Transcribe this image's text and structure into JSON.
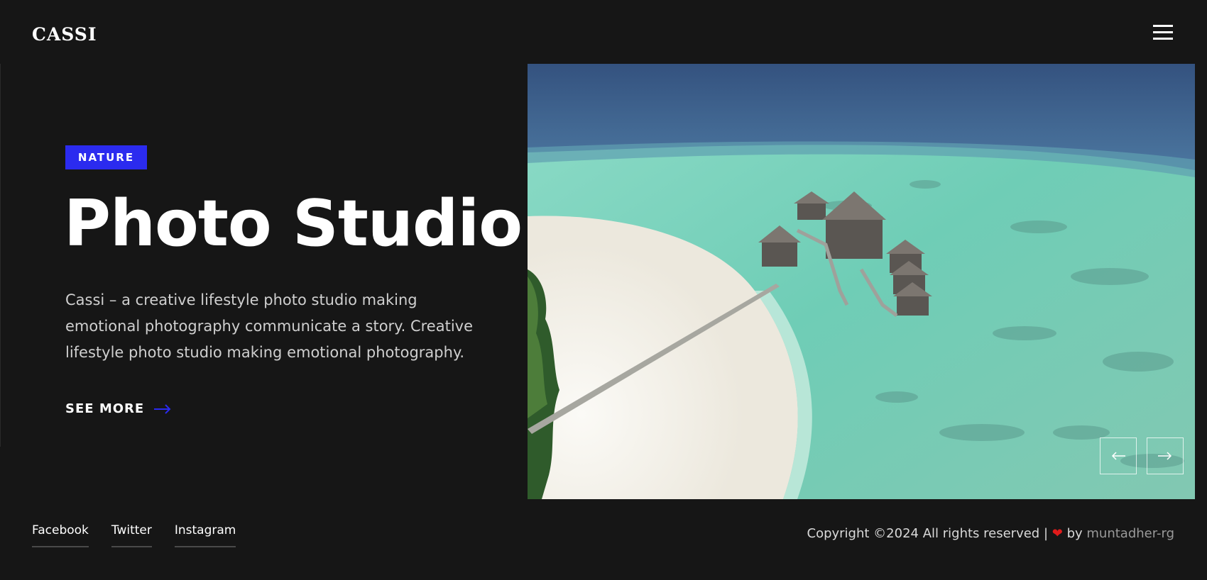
{
  "header": {
    "logo": "CASSI",
    "menu_icon": "hamburger-menu-icon"
  },
  "hero": {
    "tag": "NATURE",
    "title": "Photo Studio",
    "description": "Cassi – a creative lifestyle photo studio making emotional photography communicate a story. Creative lifestyle photo studio making emotional photography.",
    "cta_label": "SEE MORE",
    "cta_icon": "arrow-right-icon"
  },
  "slider": {
    "image": "aerial-maldives-overwater-villas",
    "prev_icon": "arrow-left-icon",
    "next_icon": "arrow-right-icon"
  },
  "footer": {
    "social": [
      {
        "label": "Facebook"
      },
      {
        "label": "Twitter"
      },
      {
        "label": "Instagram"
      }
    ],
    "copyright_text": "Copyright ©2024 All rights reserved |",
    "heart_icon": "heart-icon",
    "by_text": "by",
    "author": "muntadher-rg"
  },
  "colors": {
    "background": "#161616",
    "accent": "#2b2bef",
    "heart": "#e01b1b"
  }
}
